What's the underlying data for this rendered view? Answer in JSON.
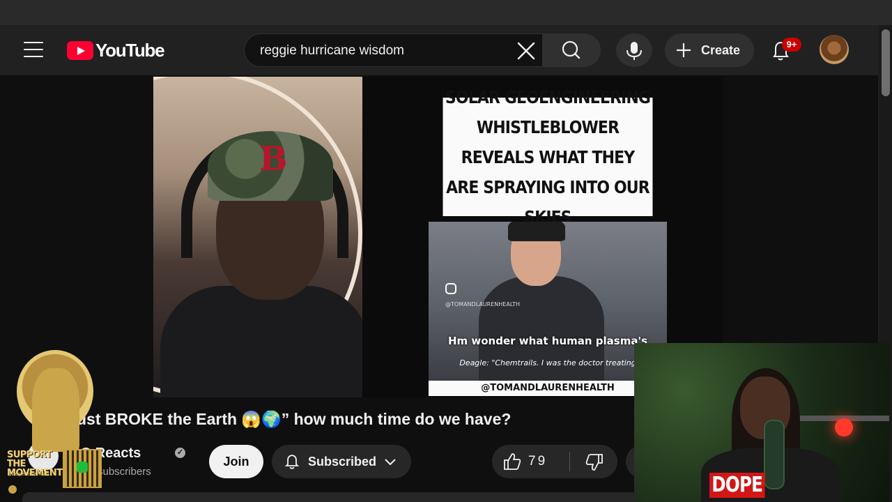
{
  "header": {
    "logo_text": "YouTube",
    "search": {
      "query": "reggie hurricane wisdom"
    },
    "create_label": "Create",
    "notifications_badge": "9+"
  },
  "player": {
    "overlay_headline": "SOLAR GEOENGINEERING WHISTLEBLOWER REVEALS WHAT THEY ARE SPRAYING INTO OUR SKIES",
    "clip_handle_small": "@TOMANDLAURENHEALTH",
    "clip_caption_1": "Hm wonder what human plasma's",
    "clip_caption_2": "Deagle: \"Chemtrails. I was the doctor treating",
    "handle_bar": "@TOMANDLAURENHEALTH",
    "cap_logo": "B"
  },
  "video": {
    "title": "ust BROKE the Earth 😱🌍” how much time do we have?",
    "channel_name": "OG Reacts",
    "subscribers": "subscribers",
    "join_label": "Join",
    "subscribed_label": "Subscribed",
    "like_count": "79"
  },
  "overlays": {
    "promo_text": "SUPPORT THE MOVEMENT",
    "promo_handle": "$DopeBohemian",
    "webcam_badge": "DOPE"
  },
  "colors": {
    "brand_red": "#ff0033",
    "background": "#0f0f0f",
    "masthead": "#212121",
    "button_bg": "#272727"
  },
  "icons": [
    "menu-icon",
    "youtube-play-icon",
    "clear-icon",
    "search-icon",
    "mic-icon",
    "plus-icon",
    "bell-icon",
    "verified-icon",
    "bell-outline-icon",
    "chevron-down-icon",
    "thumbs-up-icon",
    "thumbs-down-icon",
    "instagram-icon"
  ]
}
